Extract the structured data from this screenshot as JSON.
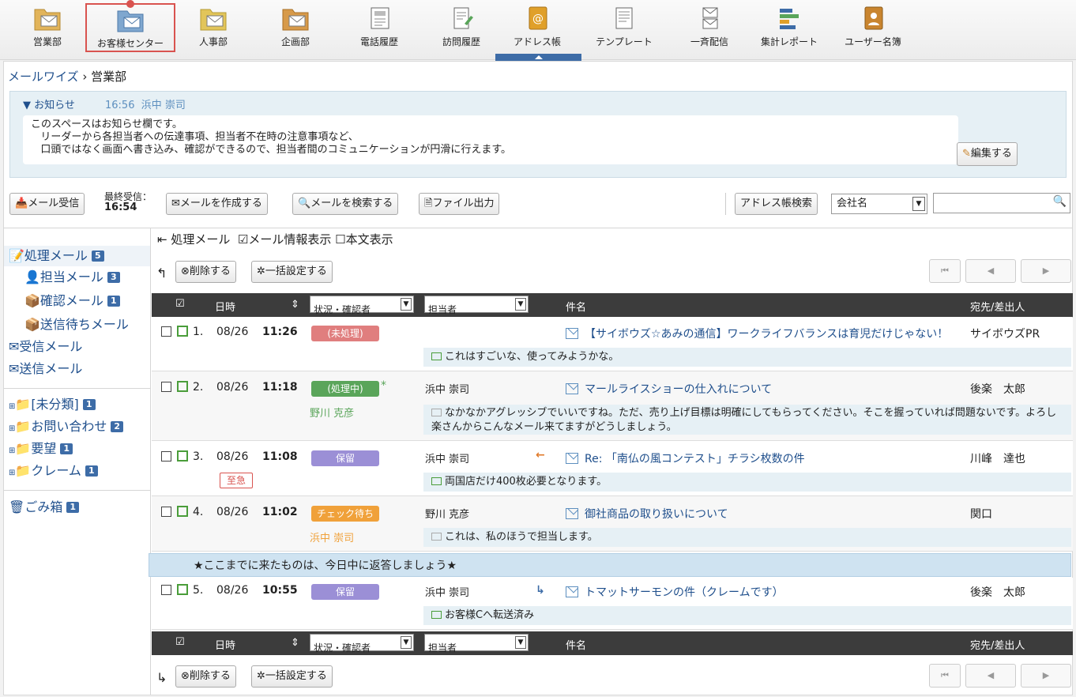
{
  "nav": {
    "items": [
      {
        "label": "営業部",
        "icon": "folder-mail-icon"
      },
      {
        "label": "お客様センター",
        "icon": "folder-mail-icon"
      },
      {
        "label": "人事部",
        "icon": "folder-mail-icon"
      },
      {
        "label": "企画部",
        "icon": "folder-mail-icon"
      },
      {
        "label": "電話履歴",
        "icon": "phone-log-icon"
      },
      {
        "label": "訪問履歴",
        "icon": "visit-log-icon"
      },
      {
        "label": "アドレス帳",
        "icon": "address-book-icon"
      },
      {
        "label": "テンプレート",
        "icon": "template-icon"
      },
      {
        "label": "一斉配信",
        "icon": "broadcast-icon"
      },
      {
        "label": "集計レポート",
        "icon": "report-icon"
      },
      {
        "label": "ユーザー名簿",
        "icon": "user-directory-icon"
      }
    ]
  },
  "breadcrumb": {
    "root": "メールワイズ",
    "sep": "›",
    "current": "営業部"
  },
  "notice": {
    "toggle": "▼ お知らせ",
    "time": "16:56",
    "author": "浜中 崇司",
    "body": "このスペースはお知らせ欄です。\n   リーダーから各担当者への伝達事項、担当者不在時の注意事項など、\n   口頭ではなく画面へ書き込み、確認ができるので、担当者間のコミュニケーションが円滑に行えます。",
    "edit_label": "編集する"
  },
  "toolbar": {
    "receive": "メール受信",
    "last_received_label": "最終受信：",
    "last_received_time": "16:54",
    "compose": "メールを作成する",
    "search": "メールを検索する",
    "export": "ファイル出力",
    "address_search": "アドレス帳検索",
    "address_field": "会社名"
  },
  "sidebar": {
    "items": [
      {
        "label": "処理メール",
        "count": "5"
      },
      {
        "label": "担当メール",
        "count": "3"
      },
      {
        "label": "確認メール",
        "count": "1"
      },
      {
        "label": "送信待ちメール",
        "count": ""
      },
      {
        "label": "受信メール",
        "count": ""
      },
      {
        "label": "送信メール",
        "count": ""
      }
    ],
    "folders": [
      {
        "label": "[未分類]",
        "count": "1"
      },
      {
        "label": "お問い合わせ",
        "count": "2"
      },
      {
        "label": "要望",
        "count": "1"
      },
      {
        "label": "クレーム",
        "count": "1"
      }
    ],
    "trash": {
      "label": "ごみ箱",
      "count": "1"
    }
  },
  "view": {
    "title": "処理メール",
    "opt_info": "メール情報表示",
    "opt_body": "本文表示",
    "opt_info_checked": true,
    "opt_body_checked": false
  },
  "actions": {
    "delete": "削除する",
    "bulk": "一括設定する"
  },
  "columns": {
    "date": "日時",
    "status": "状況・確認者",
    "assignee": "担当者",
    "subject": "件名",
    "party": "宛先/差出人"
  },
  "rows": [
    {
      "no": "1.",
      "date": "08/26",
      "time": "11:26",
      "status": "(未処理)",
      "status_color": "#e07e7e",
      "confirmer": "",
      "assignee": "",
      "arrow": "",
      "subject": "【サイボウズ☆あみの通信】ワークライフバランスは育児だけじゃない！",
      "party": "サイボウズPR",
      "comment": "これはすごいな、使ってみようかな。",
      "comment_type": "green"
    },
    {
      "no": "2.",
      "date": "08/26",
      "time": "11:18",
      "status": "(処理中)",
      "status_color": "#5aa55a",
      "confirmer": "野川 克彦",
      "mark": "*",
      "assignee": "浜中 崇司",
      "arrow": "",
      "subject": "マールライスショーの仕入れについて",
      "party": "後楽　太郎",
      "comment": "なかなかアグレッシブでいいですね。ただ、売り上げ目標は明確にしてもらってください。そこを握っていれば問題ないです。よろし",
      "comment2": "楽さんからこんなメール来てますがどうしましょう。",
      "comment_type": "grey"
    },
    {
      "no": "3.",
      "date": "08/26",
      "time": "11:08",
      "status": "保留",
      "status_color": "#9b8fd6",
      "urgent": "至急",
      "assignee": "浜中 崇司",
      "arrow": "←",
      "subject": "Re: 「南仏の風コンテスト」チラシ枚数の件",
      "party": "川峰　達也",
      "comment": "両国店だけ400枚必要となります。",
      "comment_type": "green"
    },
    {
      "no": "4.",
      "date": "08/26",
      "time": "11:02",
      "status": "チェック待ち",
      "status_color": "#f0a13a",
      "confirmer": "浜中 崇司",
      "assignee": "野川 克彦",
      "arrow": "",
      "subject": "御社商品の取り扱いについて",
      "party": "関口",
      "comment": "これは、私のほうで担当します。",
      "comment_type": "grey"
    },
    {
      "no": "5.",
      "date": "08/26",
      "time": "10:55",
      "status": "保留",
      "status_color": "#9b8fd6",
      "assignee": "浜中 崇司",
      "arrow": "↳",
      "subject": "トマットサーモンの件（クレームです）",
      "party": "後楽　太郎",
      "comment": "お客様Cへ転送済み",
      "comment_type": "green"
    }
  ],
  "banner": "★ここまでに来たものは、今日中に返答しましょう★",
  "pager": {
    "first": "⏮",
    "prev": "◀",
    "next": "▶"
  }
}
